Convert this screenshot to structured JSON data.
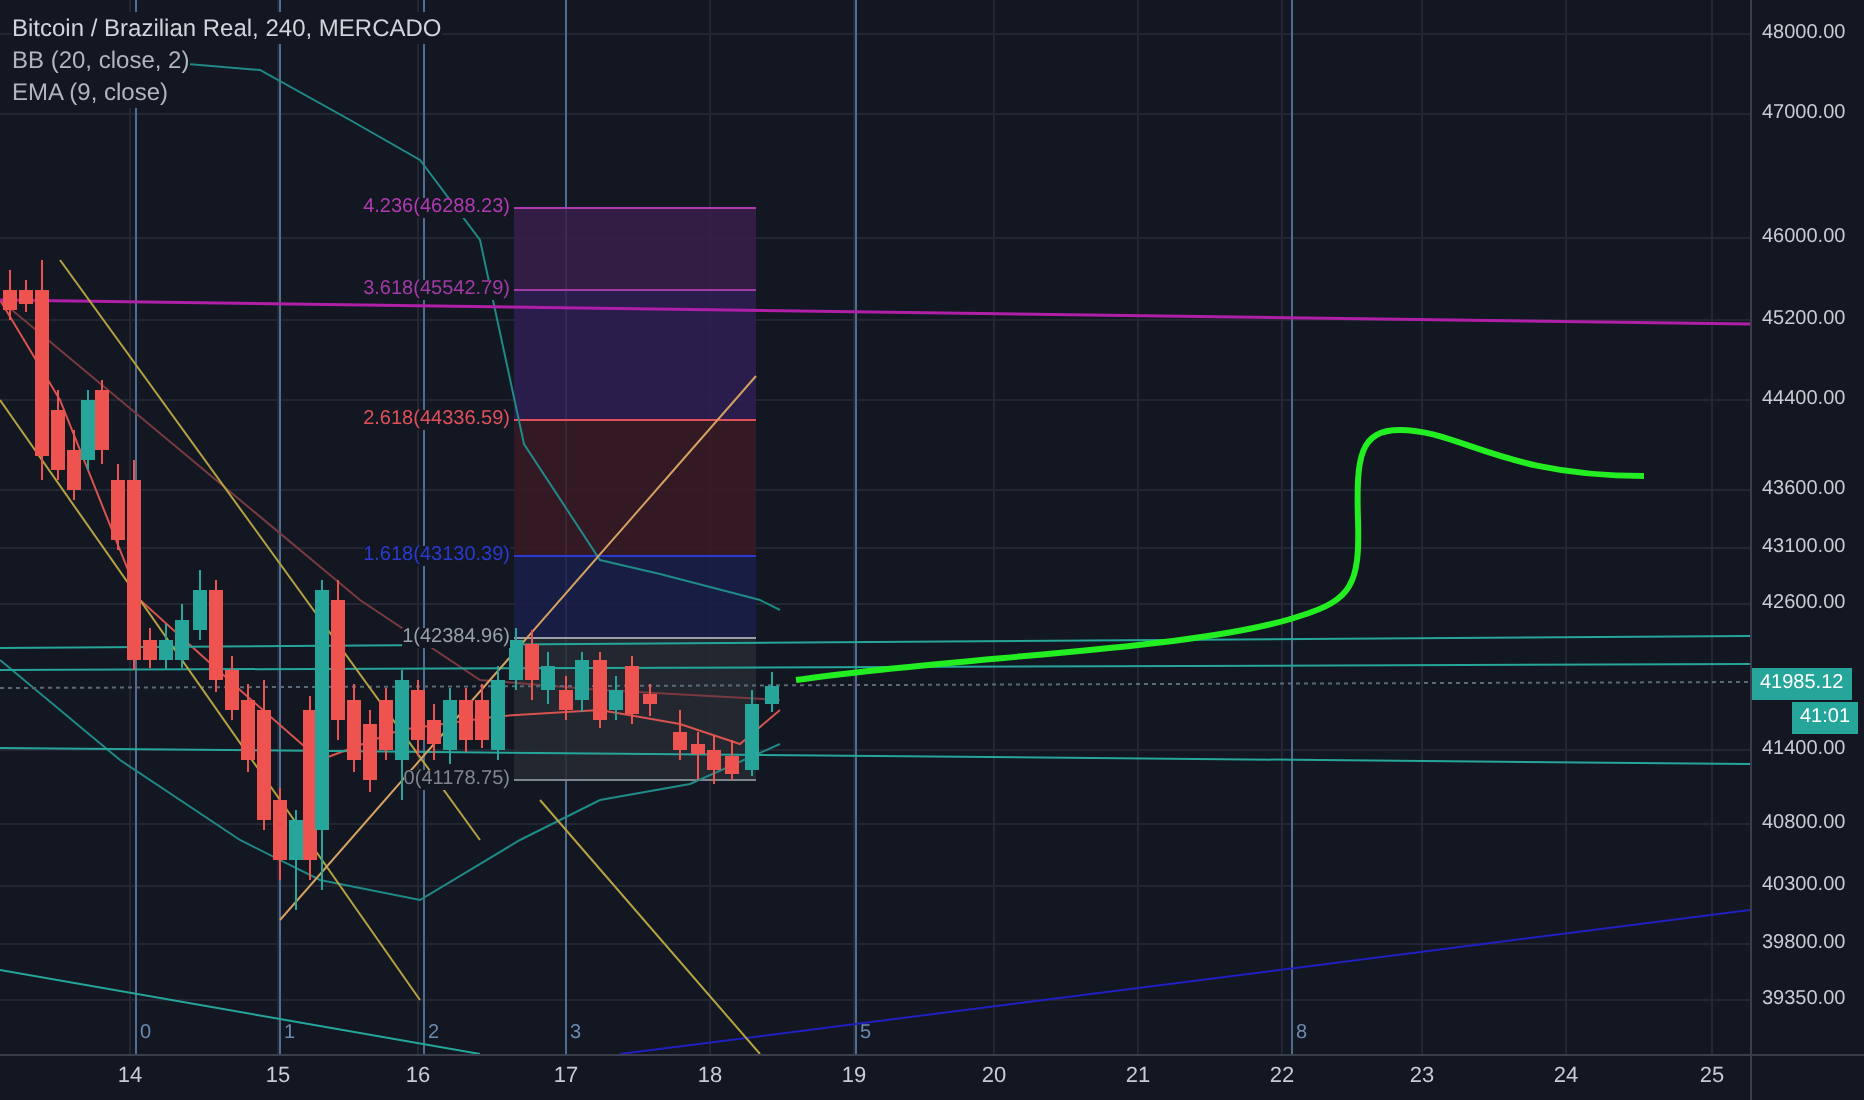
{
  "legend": {
    "title": "Bitcoin / Brazilian Real, 240, MERCADO",
    "indicators": [
      "BB (20, close, 2)",
      "EMA (9, close)"
    ]
  },
  "fib_levels": [
    {
      "label": "4.236(46288.23)",
      "color": "#b03ab0"
    },
    {
      "label": "3.618(45542.79)",
      "color": "#a23aa8"
    },
    {
      "label": "2.618(44336.59)",
      "color": "#e0505a"
    },
    {
      "label": "1.618(43130.39)",
      "color": "#2a3ad0"
    },
    {
      "label": "1(42384.96)",
      "color": "#9aa0a8"
    },
    {
      "label": "0(41178.75)",
      "color": "#80868e"
    }
  ],
  "wave_marks": [
    "0",
    "1",
    "2",
    "3",
    "5",
    "8"
  ],
  "price_axis": {
    "labels": [
      "48000.00",
      "47000.00",
      "46000.00",
      "45200.00",
      "44400.00",
      "43600.00",
      "43100.00",
      "42600.00",
      "41400.00",
      "40800.00",
      "40300.00",
      "39800.00",
      "39350.00"
    ],
    "last_price": "41985.12",
    "countdown": "41:01"
  },
  "time_axis": {
    "labels": [
      "14",
      "15",
      "16",
      "17",
      "18",
      "19",
      "20",
      "21",
      "22",
      "23",
      "24",
      "25"
    ]
  }
}
